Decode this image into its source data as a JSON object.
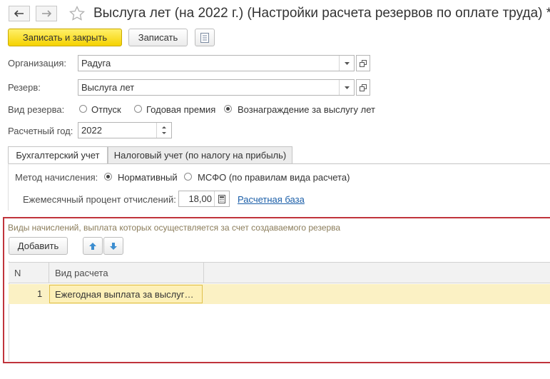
{
  "header": {
    "title": "Выслуга лет (на 2022 г.) (Настройки расчета резервов по оплате труда) *"
  },
  "toolbar": {
    "save_close_label": "Записать и закрыть",
    "save_label": "Записать"
  },
  "form": {
    "organization_label": "Организация:",
    "organization_value": "Радуга",
    "reserve_label": "Резерв:",
    "reserve_value": "Выслуга лет",
    "reserve_type_label": "Вид резерва:",
    "reserve_type_options": [
      "Отпуск",
      "Годовая премия",
      "Вознаграждение за выслугу лет"
    ],
    "reserve_type_selected": "Вознаграждение за выслугу лет",
    "year_label": "Расчетный год:",
    "year_value": "2022"
  },
  "tabs": [
    "Бухгалтерский учет",
    "Налоговый учет (по налогу на прибыль)"
  ],
  "accounting": {
    "method_label": "Метод начисления:",
    "method_options": [
      "Нормативный",
      "МСФО (по правилам вида расчета)"
    ],
    "method_selected": "Нормативный",
    "percent_label": "Ежемесячный процент отчислений:",
    "percent_value": "18,00",
    "base_link": "Расчетная база"
  },
  "accruals": {
    "section_title": "Виды начислений, выплата которых осуществляется за счет создаваемого резерва",
    "add_label": "Добавить",
    "columns": [
      "N",
      "Вид расчета"
    ],
    "rows": [
      {
        "n": "1",
        "type": "Ежегодная выплата за выслуг…"
      }
    ]
  },
  "colors": {
    "primary_button": "#f5d200",
    "highlight_frame": "#c0343c",
    "selected_row": "#fbf1c4",
    "link": "#1a5ea8"
  }
}
